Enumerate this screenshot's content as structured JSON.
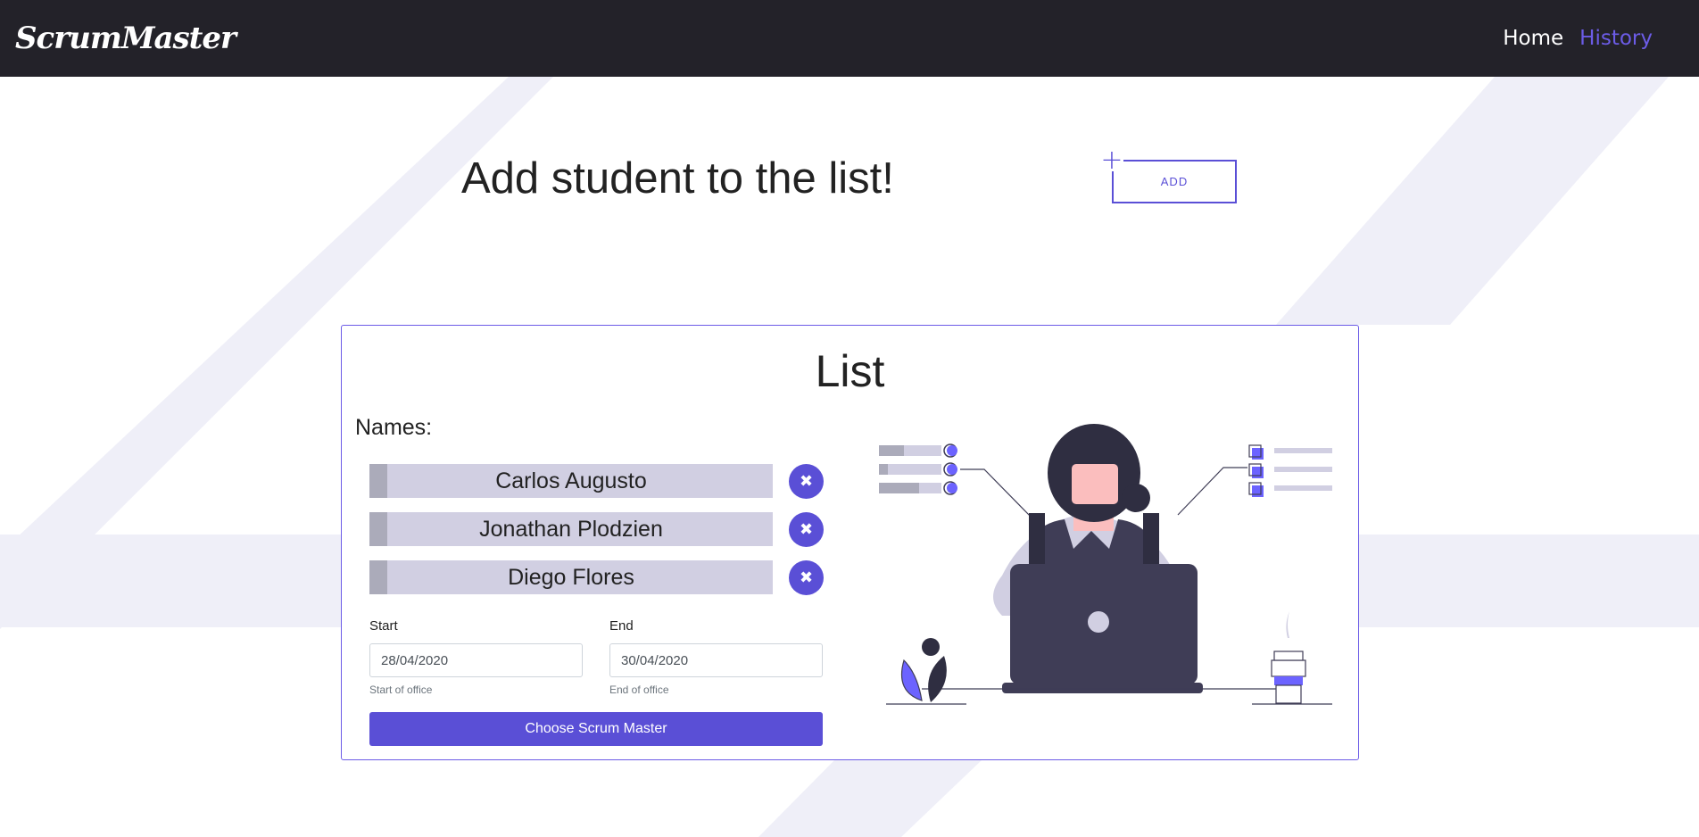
{
  "navbar": {
    "brand": "ScrumMaster",
    "links": [
      {
        "label": "Home",
        "active": false
      },
      {
        "label": "History",
        "active": true
      }
    ]
  },
  "hero": {
    "title": "Add student to the list!",
    "add_button": "ADD",
    "add_icon": "+"
  },
  "card": {
    "title": "List",
    "names_label": "Names:",
    "names": [
      "Carlos Augusto",
      "Jonathan Plodzien",
      "Diego Flores"
    ],
    "remove_icon": "✖",
    "start": {
      "label": "Start",
      "value": "28/04/2020",
      "help": "Start of office"
    },
    "end": {
      "label": "End",
      "value": "30/04/2020",
      "help": "End of office"
    },
    "submit_label": "Choose Scrum Master"
  },
  "colors": {
    "accent": "#5a4fd6",
    "navbar_bg": "#232229",
    "pill_bg": "#d1cfe2"
  }
}
